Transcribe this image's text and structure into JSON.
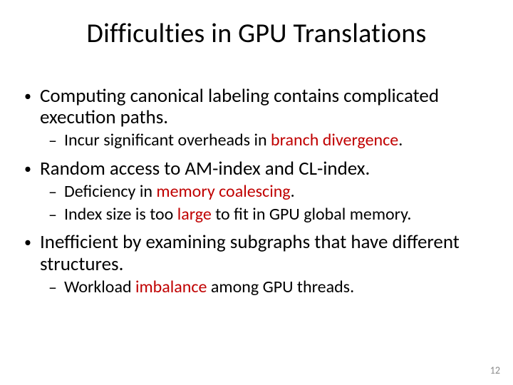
{
  "title": "Difficulties in GPU Translations",
  "b1": {
    "t1": "Computing canonical labeling contains complicated execution paths.",
    "s1_pre": "Incur significant overheads in ",
    "s1_red": "branch divergence",
    "s1_post": "."
  },
  "b2": {
    "t1": "Random access to AM-index and CL-index.",
    "s1_pre": "Deficiency in ",
    "s1_red": "memory coalescing",
    "s1_post": ".",
    "s2_pre": "Index size is too ",
    "s2_red": "large",
    "s2_post": " to fit in GPU global memory."
  },
  "b3": {
    "t1": "Inefficient by examining subgraphs that have different structures.",
    "s1_pre": "Workload ",
    "s1_red": "imbalance",
    "s1_post": " among GPU threads."
  },
  "page": "12",
  "glyph": {
    "dot": "•",
    "dash": "–"
  }
}
